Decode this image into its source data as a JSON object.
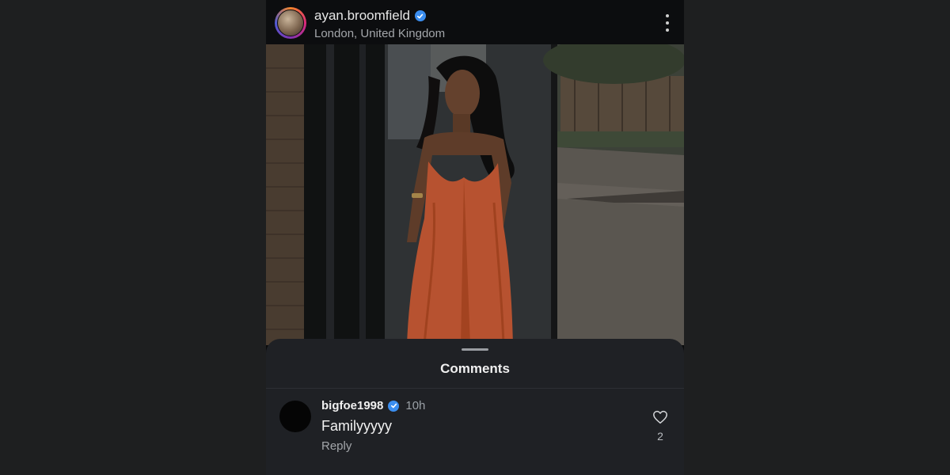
{
  "header": {
    "username": "ayan.broomfield",
    "location": "London, United Kingdom",
    "verified": true
  },
  "comments_sheet": {
    "title": "Comments",
    "comments": [
      {
        "username": "bigfoe1998",
        "verified": true,
        "time": "10h",
        "text": "Familyyyyy",
        "reply_label": "Reply",
        "like_count": "2"
      }
    ]
  },
  "icons": {
    "verified": "verified-badge-icon",
    "more": "more-options-icon",
    "like": "heart-icon"
  },
  "colors": {
    "verified_blue": "#3b8ef0",
    "dress_orange": "#e0653b",
    "sheet_bg": "#1f2125"
  }
}
